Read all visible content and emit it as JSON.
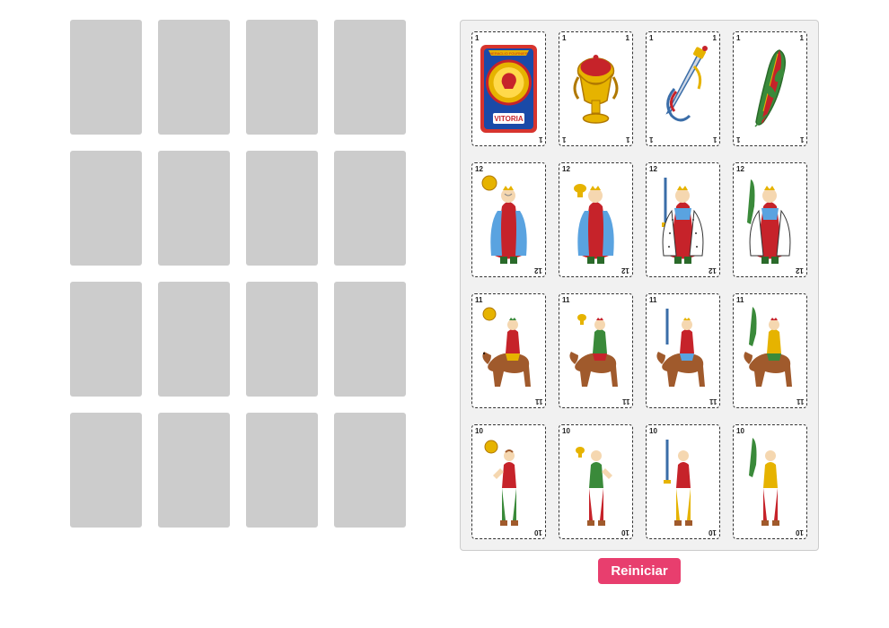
{
  "controls": {
    "restart_label": "Reiniciar"
  },
  "deck_style": "spanish_baraja",
  "suits": [
    "oros",
    "copas",
    "espadas",
    "bastos"
  ],
  "slots": {
    "count": 16,
    "layout": "4x4",
    "state": "empty"
  },
  "tray_cards": [
    {
      "rank": 1,
      "suit": "oros",
      "label": "As de Oros",
      "is_brand_card": true,
      "brand_text_top": "HERACLIO FOURNIER",
      "brand_text_bottom": "VITORIA"
    },
    {
      "rank": 1,
      "suit": "copas",
      "label": "As de Copas"
    },
    {
      "rank": 1,
      "suit": "espadas",
      "label": "As de Espadas"
    },
    {
      "rank": 1,
      "suit": "bastos",
      "label": "As de Bastos"
    },
    {
      "rank": 12,
      "suit": "oros",
      "label": "Rey de Oros"
    },
    {
      "rank": 12,
      "suit": "copas",
      "label": "Rey de Copas"
    },
    {
      "rank": 12,
      "suit": "espadas",
      "label": "Rey de Espadas"
    },
    {
      "rank": 12,
      "suit": "bastos",
      "label": "Rey de Bastos"
    },
    {
      "rank": 11,
      "suit": "oros",
      "label": "Caballo de Oros"
    },
    {
      "rank": 11,
      "suit": "copas",
      "label": "Caballo de Copas"
    },
    {
      "rank": 11,
      "suit": "espadas",
      "label": "Caballo de Espadas"
    },
    {
      "rank": 11,
      "suit": "bastos",
      "label": "Caballo de Bastos"
    },
    {
      "rank": 10,
      "suit": "oros",
      "label": "Sota de Oros"
    },
    {
      "rank": 10,
      "suit": "copas",
      "label": "Sota de Copas"
    },
    {
      "rank": 10,
      "suit": "espadas",
      "label": "Sota de Espadas"
    },
    {
      "rank": 10,
      "suit": "bastos",
      "label": "Sota de Bastos"
    }
  ],
  "colors": {
    "accent": "#e83e6e",
    "slot_bg": "#cccccc",
    "tray_bg": "#f1f1f1",
    "gold": "#e6b300",
    "cup": "#e6b300",
    "sword": "#3a6da8",
    "club": "#3a8a3a",
    "king_robe": "#c6232a",
    "king_mantle": "#5aa3e0",
    "horse": "#a05a2c",
    "skin": "#f5d7b0"
  }
}
